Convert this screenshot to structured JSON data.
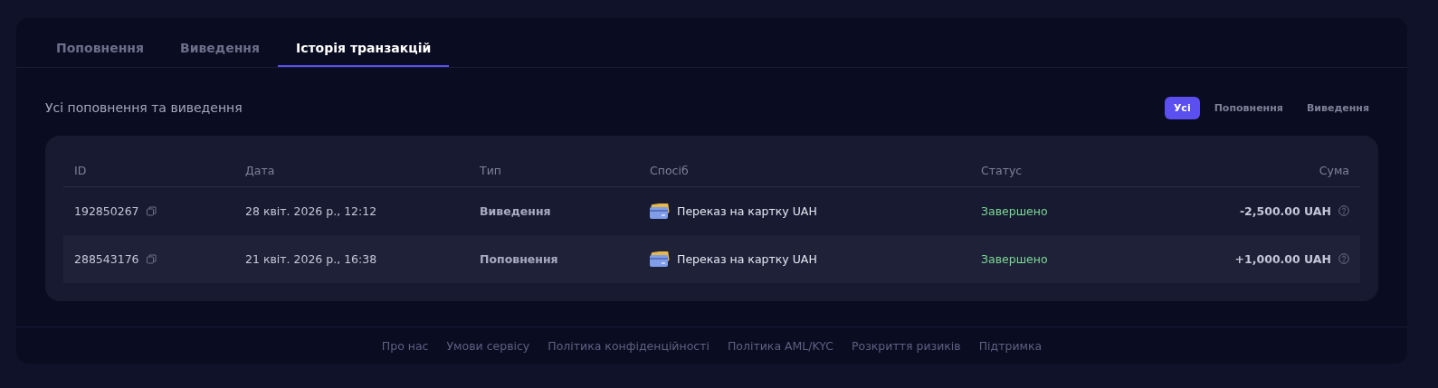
{
  "tabs": [
    {
      "label": "Поповнення",
      "selected": false
    },
    {
      "label": "Виведення",
      "selected": false
    },
    {
      "label": "Історія транзакцій",
      "selected": true
    }
  ],
  "section_title": "Усі поповнення та виведення",
  "filters": [
    {
      "label": "Усі",
      "selected": true
    },
    {
      "label": "Поповнення",
      "selected": false
    },
    {
      "label": "Виведення",
      "selected": false
    }
  ],
  "table": {
    "columns": [
      "ID",
      "Дата",
      "Тип",
      "Спосіб",
      "Статус",
      "Сума"
    ],
    "rows": [
      {
        "id": "192850267",
        "date": "28 квіт. 2026 р., 12:12",
        "type": "Виведення",
        "method": "Переказ на картку UAH",
        "status": "Завершено",
        "amount": "-2,500.00 UAH"
      },
      {
        "id": "288543176",
        "date": "21 квіт. 2026 р., 16:38",
        "type": "Поповнення",
        "method": "Переказ на картку UAH",
        "status": "Завершено",
        "amount": "+1,000.00 UAH"
      }
    ]
  },
  "footer_links": [
    "Про нас",
    "Умови сервісу",
    "Політика конфіденційності",
    "Політика AML/KYC",
    "Розкриття ризиків",
    "Підтримка"
  ]
}
